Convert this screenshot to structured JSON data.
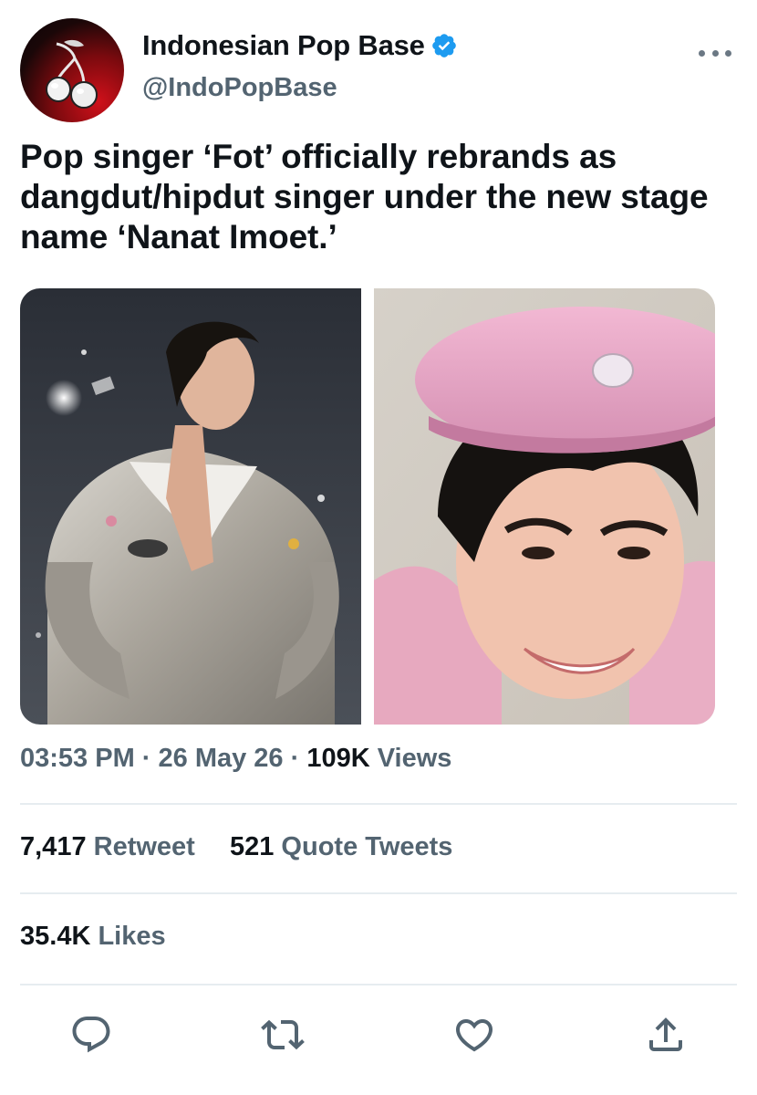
{
  "account": {
    "display_name": "Indonesian Pop Base",
    "handle": "@IndoPopBase",
    "verified": true,
    "avatar_icon": "cherry-logo-icon"
  },
  "tweet": {
    "text": "Pop singer ‘Fot’ officially rebrands as dangdut/hipdut singer under the new stage name ‘Nanat Imoet.’",
    "time": "03:53 PM",
    "date": "26 May 26",
    "views_count": "109K",
    "views_label": "Views"
  },
  "stats": {
    "retweets_count": "7,417",
    "retweets_label": "Retweet",
    "quotes_count": "521",
    "quotes_label": "Quote Tweets",
    "likes_count": "35.4K",
    "likes_label": "Likes"
  },
  "actions": {
    "reply_icon": "reply-icon",
    "retweet_icon": "retweet-icon",
    "like_icon": "heart-icon",
    "share_icon": "share-icon"
  },
  "colors": {
    "text": "#0f1419",
    "secondary": "#536471",
    "verified_blue": "#1d9bf0",
    "divider": "#e6ecf0"
  }
}
